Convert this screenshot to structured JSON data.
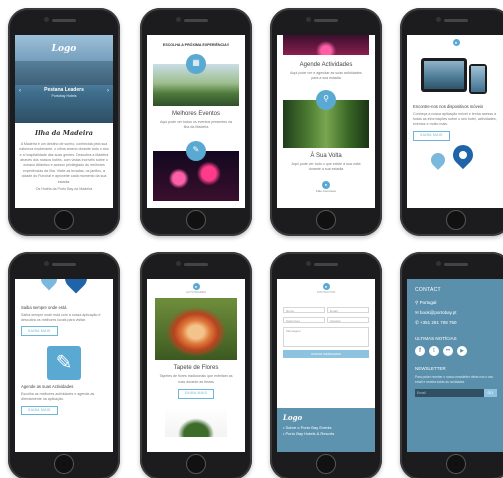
{
  "phone1": {
    "logo": "Logo",
    "hero_title": "Pestana Leaders",
    "hero_sub": "Portobay Hotels",
    "section_title": "Ilha da Madeira",
    "body_text": "A Madeira é um destino de sonho, conhecida pela sua natureza exuberante, o clima ameno durante todo o ano e a hospitalidade das suas gentes. Descubra a Madeira através dos nossos hotéis, com vistas incríveis sobre o oceano Atlântico e acesso privilegiado às melhores experiências da ilha. Visite as levadas, os jardins, a cidade do Funchal e aproveite cada momento da sua estadia.",
    "footer_text": "Os Hotéis da Porto Bay na Madeira"
  },
  "phone2": {
    "header": "ESCOLHA A PRÓXIMA EXPERIÊNCIA!!",
    "card1_title": "Melhores Eventos",
    "card1_text": "Aqui pode ver todos os eventos presentes na Ilha da Madeira",
    "card2_title": ""
  },
  "phone3": {
    "card1_title": "Agende Actividades",
    "card1_text": "Aqui pode ver e agendar as suas actividades para a sua estadia",
    "card2_title": "À Sua Volta",
    "card2_text": "Aqui pode ver tudo o que existe à sua volta durante a sua estadia",
    "footer_label": "Fale Connosco"
  },
  "phone4": {
    "title": "Encontre-nos nos dispositivos móveis",
    "text": "Conheça a nossa aplicação móvel e tenha acesso a todas as informações sobre o seu hotel, actividades, eventos e muito mais.",
    "button": "SAIBA MAIS"
  },
  "phone5": {
    "title1": "Saiba sempre onde está",
    "text1": "Saiba sempre onde está com a nossa aplicação e descubra os melhores locais para visitar.",
    "button1": "SAIBA MAIS",
    "title2": "Agende as suas Actividades",
    "text2": "Escolha as melhores actividades e agende-as directamente na aplicação.",
    "button2": "SAIBA MAIS"
  },
  "phone6": {
    "header": "ACTIVIDADES",
    "card_title": "Tapete de Flores",
    "card_text": "Tapetes de flores tradicionais que enfeitam as ruas durante as festas",
    "button": "SAIBA MAIS"
  },
  "phone7": {
    "header": "CONTACTOS",
    "fields": [
      "Nome",
      "Email",
      "Telemóvel",
      "Assunto",
      "Mensagem"
    ],
    "submit": "ENVIAR MENSAGEM",
    "logo": "Logo",
    "footer_links": [
      "Sobre o Porto Bay Events",
      "Porto Bay Hotels & Resorts"
    ]
  },
  "phone8": {
    "contact_heading": "CONTACT",
    "location": "Portugal",
    "email": "book@portobay.pt",
    "phone": "+351 291 708 750",
    "news_heading": "ULTIMAS NOTÍCIAS",
    "newsletter_heading": "NEWSLETTER",
    "newsletter_text": "Para poder receber o nosso newsletter deixe-nos o seu email e receba todas as novidades",
    "email_placeholder": "Email",
    "go": "GO"
  },
  "colors": {
    "accent": "#5aa9d3",
    "footer_blue": "#5b90ad",
    "dark_footer": "#5e93b0"
  }
}
